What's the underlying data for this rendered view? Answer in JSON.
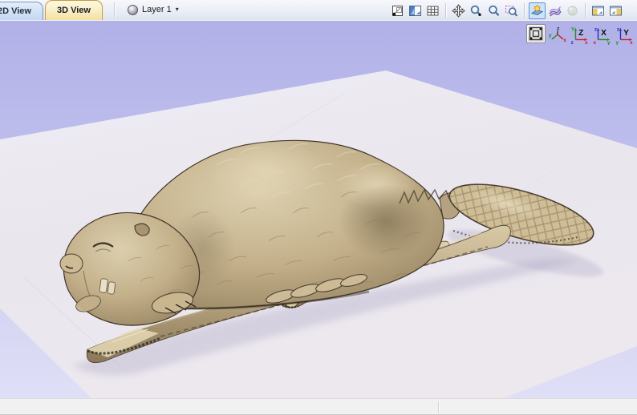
{
  "tab_bar": {
    "tabs": [
      {
        "id": "tab-2d-view",
        "label": "2D View",
        "active": false
      },
      {
        "id": "tab-3d-view",
        "label": "3D View",
        "active": true
      }
    ],
    "layer_selector": {
      "icon": "layer-sphere-icon",
      "label": "Layer 1",
      "caret": "▾"
    },
    "toolbar_groups": [
      {
        "icons": [
          "fit-to-material-icon",
          "split-view-icon",
          "grid-icon"
        ]
      },
      {
        "icons": [
          "pan-view-icon",
          "zoom-interactive-icon",
          "zoom-scale-icon",
          "zoom-box-icon"
        ]
      },
      {
        "icons": [
          "toggle-shading-icon",
          "toolpath-preview-icon",
          "solid-model-icon"
        ]
      },
      {
        "icons": [
          "layout-panel-left-icon",
          "layout-panel-right-icon"
        ]
      }
    ]
  },
  "view_controls": {
    "iso_button": {
      "name": "isometric-view-button",
      "pressed": true
    },
    "axes_button": {
      "name": "rotate-3d-axes-button",
      "up_label": "z",
      "left_label": "y",
      "right_label": "x"
    },
    "plane_buttons": [
      {
        "name": "view-down-z-button",
        "big_label": "Z",
        "up_label": "Y",
        "right_label": "x",
        "corner_label": "z"
      },
      {
        "name": "view-along-x-button",
        "big_label": "X",
        "up_label": "z",
        "right_label": "y",
        "corner_label": "x"
      },
      {
        "name": "view-along-y-button",
        "big_label": "Y",
        "up_label": "z",
        "right_label": "x",
        "corner_label": "y"
      }
    ]
  },
  "viewport_scene": {
    "model": "beaver-relief-carving",
    "surface": "material-block"
  },
  "colors": {
    "viewport_top": "#b1b1e8",
    "viewport_bottom": "#dfdff7",
    "material_face": "#eae7ef",
    "model_light": "#dccfae",
    "model_mid": "#c3b08a",
    "model_dark": "#8a7757",
    "axis_x": "#cc2222",
    "axis_y": "#1f8f1f",
    "axis_z": "#2b2bb0",
    "active_tab_face": "#f9eec2",
    "active_tab_border": "#c39b3e",
    "inactive_tab_face": "#c3d8f0",
    "inactive_tab_border": "#6f9cc9",
    "toolbar_blue": "#4a7ec8",
    "toolbar_purple": "#7a5ab0",
    "toolbar_magenta": "#d053c8",
    "pressed_bg": "#cfe3f8",
    "pressed_border": "#5b96d2",
    "statusbar_bg": "#f1f1f1"
  }
}
